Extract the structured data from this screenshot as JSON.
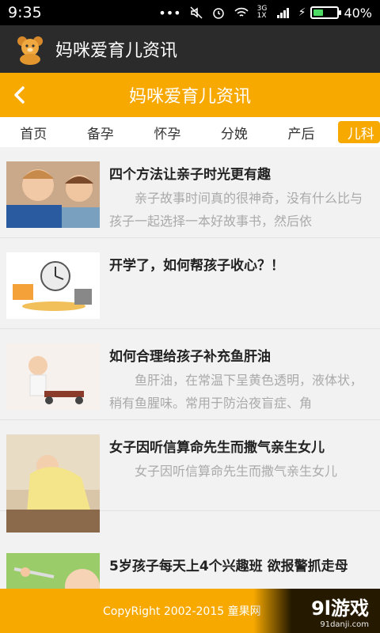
{
  "status_bar": {
    "time": "9:35",
    "dots": "•••",
    "network": "3G 1X",
    "battery": "40%",
    "battery_level": 0.4
  },
  "app_bar": {
    "title": "妈咪爱育儿资讯"
  },
  "header": {
    "title": "妈咪爱育儿资讯"
  },
  "tabs": [
    {
      "label": "首页"
    },
    {
      "label": "备孕"
    },
    {
      "label": "怀孕"
    },
    {
      "label": "分娩"
    },
    {
      "label": "产后"
    },
    {
      "label": "儿科"
    }
  ],
  "articles": [
    {
      "title": "四个方法让亲子时光更有趣",
      "summary": "亲子故事时间真的很神奇，没有什么比与孩子一起选择一本好故事书，然后依"
    },
    {
      "title": "开学了，如何帮孩子收心？！",
      "summary": ""
    },
    {
      "title": "如何合理给孩子补充鱼肝油",
      "summary": "鱼肝油，在常温下呈黄色透明，液体状，稍有鱼腥味。常用于防治夜盲症、角"
    },
    {
      "title": "女子因听信算命先生而撒气亲生女儿",
      "summary": "女子因听信算命先生而撒气亲生女儿"
    },
    {
      "title": "5岁孩子每天上4个兴趣班 欲报警抓走母",
      "summary": ""
    }
  ],
  "footer": {
    "copyright": "CopyRight 2002-2015 童果网"
  },
  "watermark": {
    "main": "9l游戏",
    "sub": "91danji.com"
  },
  "colors": {
    "accent": "#f7a900",
    "appbar": "#2b2b2b"
  }
}
